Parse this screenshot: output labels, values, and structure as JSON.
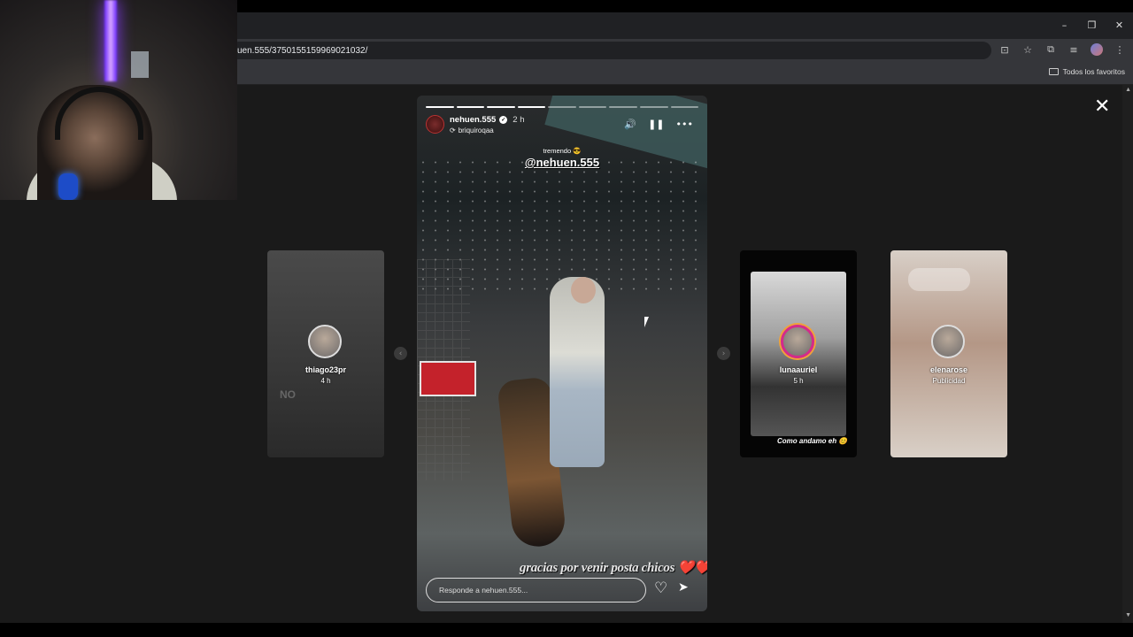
{
  "browser": {
    "url": "uen.555/3750155159969021032/",
    "bookmarks_folder": "Todos los favoritos",
    "window_controls": {
      "minimize": "–",
      "restore": "❐",
      "close": "✕"
    },
    "toolbar_icons": [
      "install-icon",
      "star-icon",
      "extensions-icon",
      "media-icon",
      "profile-avatar",
      "menu-icon"
    ]
  },
  "story": {
    "username": "nehuen.555",
    "time": "2 h",
    "reshared_from": "briquiroqaa",
    "sticker_small": "tremendo 😎",
    "mention": "@nehuen.555",
    "caption": "gracias por venir posta chicos",
    "caption_emoji": "❤️❤️",
    "reply_placeholder": "Responde a nehuen.555...",
    "progress": {
      "total": 9,
      "current": 4
    }
  },
  "adjacent_stories": [
    {
      "username": "thiago23pr",
      "meta": "4 h",
      "overlay_text": "NO"
    },
    {
      "username": "lunaauriel",
      "meta": "5 h",
      "inner_caption": "Como andamo eh 😊"
    },
    {
      "username": "elenarose",
      "meta": "Publicidad"
    }
  ],
  "icons": {
    "close": "✕",
    "prev": "‹",
    "next": "›",
    "sound": "🔊",
    "pause": "❚❚",
    "more": "•••",
    "heart": "♡",
    "send": "➤"
  }
}
